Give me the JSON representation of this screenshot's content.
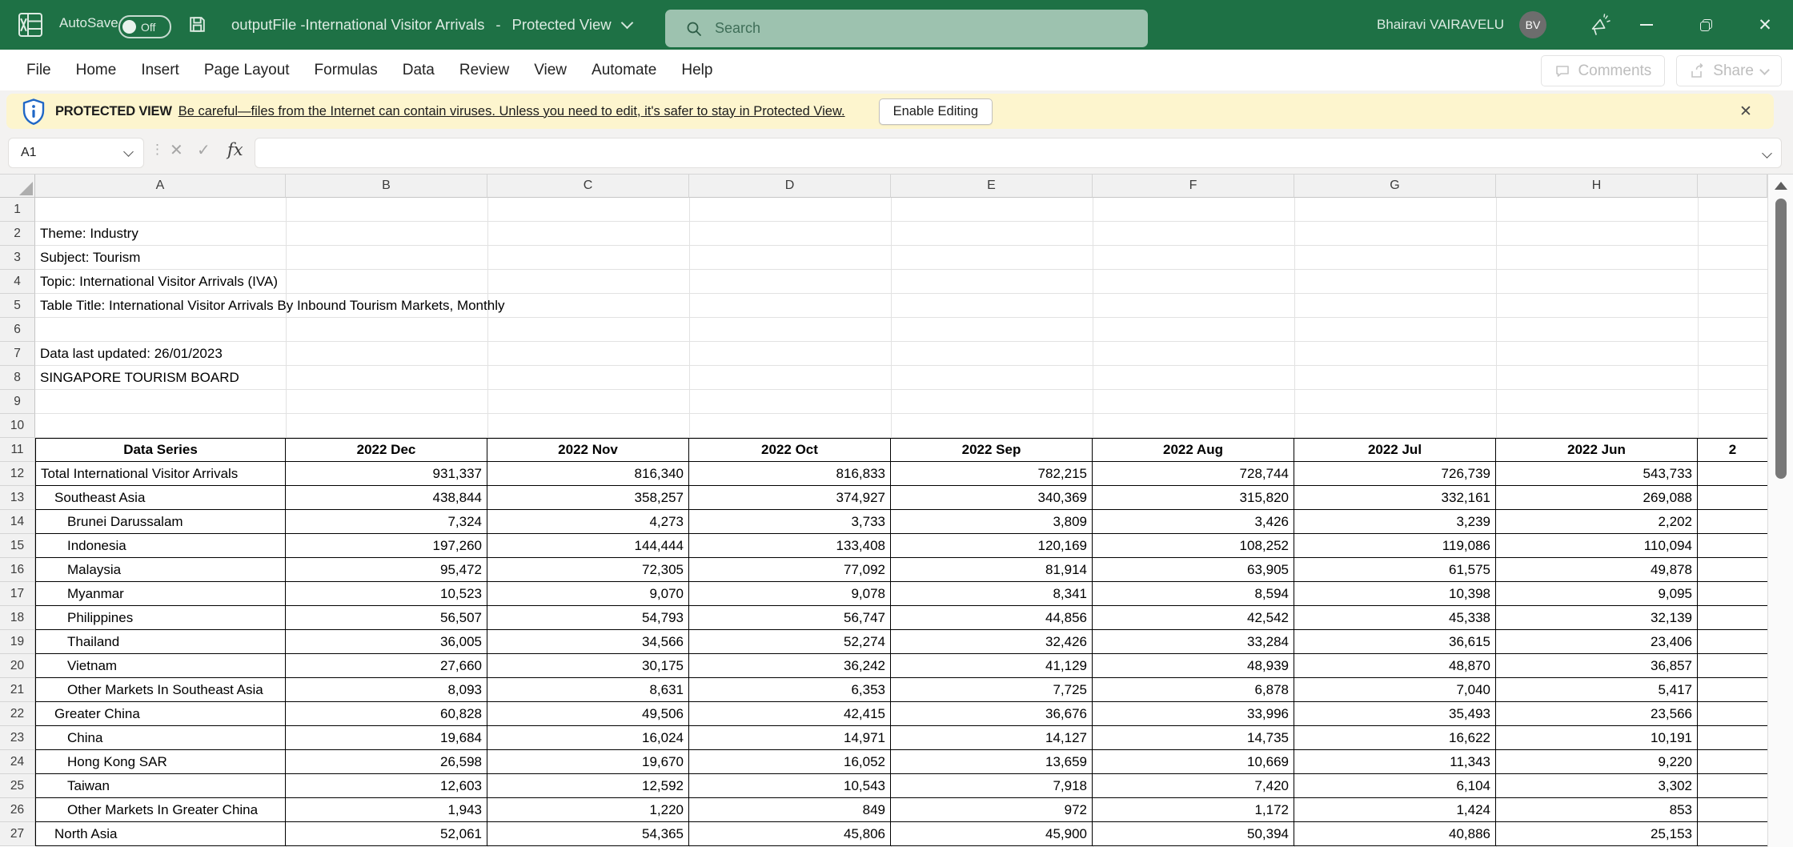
{
  "colors": {
    "titlebar_green": "#1e7145",
    "search_pill": "#9dc2af",
    "banner_yellow": "#fdf5ce",
    "shield_blue": "#2067c6",
    "table_border": "#000000",
    "header_gray": "#f1f1f1"
  },
  "title_bar": {
    "autosave_label": "AutoSave",
    "autosave_state": "Off",
    "document_title": "outputFile -International Visitor Arrivals",
    "separator": "-",
    "protected_view": "Protected View",
    "search_placeholder": "Search",
    "user_name": "Bhairavi VAIRAVELU",
    "user_initials": "BV"
  },
  "menu_bar": {
    "items": [
      "File",
      "Home",
      "Insert",
      "Page Layout",
      "Formulas",
      "Data",
      "Review",
      "View",
      "Automate",
      "Help"
    ],
    "comments_label": "Comments",
    "share_label": "Share"
  },
  "message_bar": {
    "label": "PROTECTED VIEW",
    "message": "Be careful—files from the Internet can contain viruses. Unless you need to edit, it's safer to stay in Protected View.",
    "button_label": "Enable Editing"
  },
  "formula_bar": {
    "name_box": "A1",
    "fx_label": "fx",
    "formula_value": ""
  },
  "grid": {
    "column_headers": [
      "A",
      "B",
      "C",
      "D",
      "E",
      "F",
      "G",
      "H"
    ],
    "row_numbers": [
      1,
      2,
      3,
      4,
      5,
      6,
      7,
      8,
      9,
      10,
      11,
      12,
      13,
      14,
      15,
      16,
      17,
      18,
      19,
      20,
      21,
      22,
      23,
      24,
      25,
      26,
      27
    ]
  },
  "sheet": {
    "meta": [
      {
        "row": 2,
        "text": "Theme: Industry"
      },
      {
        "row": 3,
        "text": "Subject: Tourism"
      },
      {
        "row": 4,
        "text": "Topic: International Visitor Arrivals (IVA)"
      },
      {
        "row": 5,
        "text": "Table Title: International Visitor Arrivals By Inbound Tourism Markets, Monthly"
      },
      {
        "row": 7,
        "text": "Data last updated: 26/01/2023"
      },
      {
        "row": 8,
        "text": "SINGAPORE TOURISM BOARD"
      }
    ],
    "table": {
      "header": [
        "Data Series",
        "2022 Dec",
        "2022 Nov",
        "2022 Oct",
        "2022 Sep",
        "2022 Aug",
        "2022 Jul",
        "2022 Jun"
      ],
      "partial_header": "2",
      "rows": [
        {
          "label": "Total International Visitor Arrivals",
          "indent": 0,
          "values": [
            "931,337",
            "816,340",
            "816,833",
            "782,215",
            "728,744",
            "726,739",
            "543,733"
          ]
        },
        {
          "label": "Southeast Asia",
          "indent": 1,
          "values": [
            "438,844",
            "358,257",
            "374,927",
            "340,369",
            "315,820",
            "332,161",
            "269,088"
          ]
        },
        {
          "label": "Brunei Darussalam",
          "indent": 2,
          "values": [
            "7,324",
            "4,273",
            "3,733",
            "3,809",
            "3,426",
            "3,239",
            "2,202"
          ]
        },
        {
          "label": "Indonesia",
          "indent": 2,
          "values": [
            "197,260",
            "144,444",
            "133,408",
            "120,169",
            "108,252",
            "119,086",
            "110,094"
          ]
        },
        {
          "label": "Malaysia",
          "indent": 2,
          "values": [
            "95,472",
            "72,305",
            "77,092",
            "81,914",
            "63,905",
            "61,575",
            "49,878"
          ]
        },
        {
          "label": "Myanmar",
          "indent": 2,
          "values": [
            "10,523",
            "9,070",
            "9,078",
            "8,341",
            "8,594",
            "10,398",
            "9,095"
          ]
        },
        {
          "label": "Philippines",
          "indent": 2,
          "values": [
            "56,507",
            "54,793",
            "56,747",
            "44,856",
            "42,542",
            "45,338",
            "32,139"
          ]
        },
        {
          "label": "Thailand",
          "indent": 2,
          "values": [
            "36,005",
            "34,566",
            "52,274",
            "32,426",
            "33,284",
            "36,615",
            "23,406"
          ]
        },
        {
          "label": "Vietnam",
          "indent": 2,
          "values": [
            "27,660",
            "30,175",
            "36,242",
            "41,129",
            "48,939",
            "48,870",
            "36,857"
          ]
        },
        {
          "label": "Other Markets In Southeast Asia",
          "indent": 2,
          "values": [
            "8,093",
            "8,631",
            "6,353",
            "7,725",
            "6,878",
            "7,040",
            "5,417"
          ]
        },
        {
          "label": "Greater China",
          "indent": 1,
          "values": [
            "60,828",
            "49,506",
            "42,415",
            "36,676",
            "33,996",
            "35,493",
            "23,566"
          ]
        },
        {
          "label": "China",
          "indent": 2,
          "values": [
            "19,684",
            "16,024",
            "14,971",
            "14,127",
            "14,735",
            "16,622",
            "10,191"
          ]
        },
        {
          "label": "Hong Kong SAR",
          "indent": 2,
          "values": [
            "26,598",
            "19,670",
            "16,052",
            "13,659",
            "10,669",
            "11,343",
            "9,220"
          ]
        },
        {
          "label": "Taiwan",
          "indent": 2,
          "values": [
            "12,603",
            "12,592",
            "10,543",
            "7,918",
            "7,420",
            "6,104",
            "3,302"
          ]
        },
        {
          "label": "Other Markets In Greater China",
          "indent": 2,
          "values": [
            "1,943",
            "1,220",
            "849",
            "972",
            "1,172",
            "1,424",
            "853"
          ]
        },
        {
          "label": "North Asia",
          "indent": 1,
          "values": [
            "52,061",
            "54,365",
            "45,806",
            "45,900",
            "50,394",
            "40,886",
            "25,153"
          ]
        }
      ]
    }
  }
}
